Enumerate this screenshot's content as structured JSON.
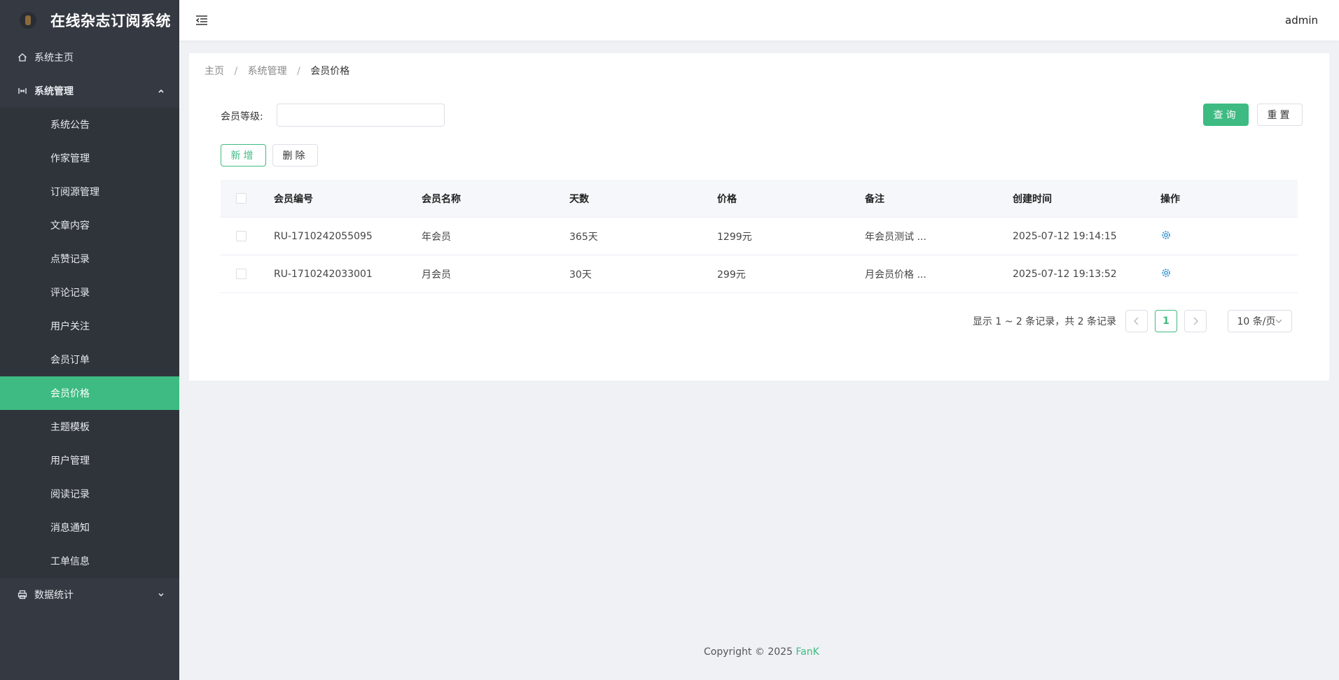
{
  "brand": {
    "title": "在线杂志订阅系统"
  },
  "header": {
    "user": "admin"
  },
  "sidebar": {
    "home": "系统主页",
    "group_system": "系统管理",
    "items": [
      "系统公告",
      "作家管理",
      "订阅源管理",
      "文章内容",
      "点赞记录",
      "评论记录",
      "用户关注",
      "会员订单",
      "会员价格",
      "主题模板",
      "用户管理",
      "阅读记录",
      "消息通知",
      "工单信息"
    ],
    "active_index": 8,
    "group_stats": "数据统计"
  },
  "breadcrumb": {
    "home": "主页",
    "sep": "/",
    "parent": "系统管理",
    "current": "会员价格"
  },
  "filter": {
    "label": "会员等级:",
    "value": "",
    "placeholder": ""
  },
  "buttons": {
    "query": "查询",
    "reset": "重置",
    "add": "新增",
    "delete": "删除"
  },
  "table": {
    "headers": [
      "会员编号",
      "会员名称",
      "天数",
      "价格",
      "备注",
      "创建时间",
      "操作"
    ],
    "rows": [
      [
        "RU-1710242055095",
        "年会员",
        "365天",
        "1299元",
        "年会员测试 ...",
        "2025-07-12 19:14:15"
      ],
      [
        "RU-1710242033001",
        "月会员",
        "30天",
        "299元",
        "月会员价格 ...",
        "2025-07-12 19:13:52"
      ]
    ]
  },
  "pagination": {
    "total_text": "显示 1 ~ 2 条记录，共 2 条记录",
    "current_page": "1",
    "page_size": "10 条/页"
  },
  "footer": {
    "copyright": "Copyright © 2025",
    "author": "FanK"
  },
  "colors": {
    "accent": "#3ebb82",
    "sidebar_bg": "#353a42",
    "submenu_bg": "#2f343b",
    "page_bg": "#eff1f4"
  }
}
